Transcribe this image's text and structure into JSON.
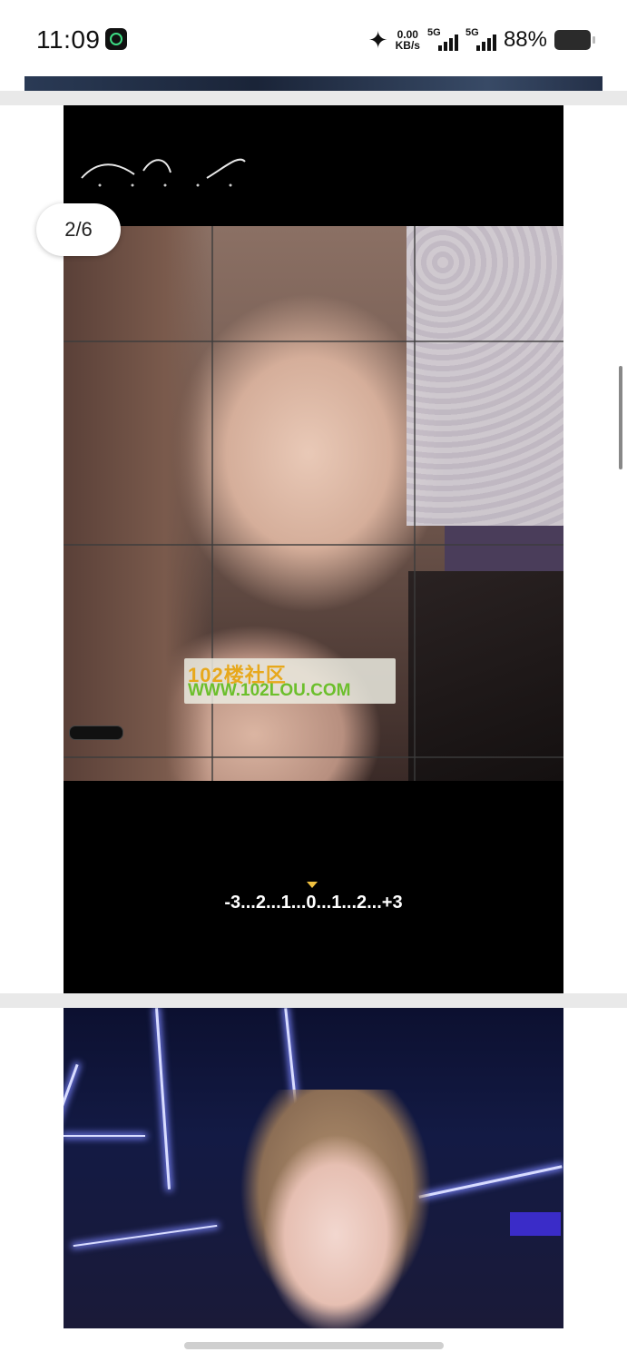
{
  "status_bar": {
    "time": "11:09",
    "net_speed_value": "0.00",
    "net_speed_unit": "KB/s",
    "sim1_label": "5G",
    "sim2_label": "5G",
    "battery_percent": "88%",
    "icons": [
      "app-notification-icon",
      "bluetooth-icon",
      "signal-icon",
      "battery-icon"
    ]
  },
  "viewer": {
    "page_indicator": "2/6"
  },
  "photo_1": {
    "watermark_title": "102楼社区",
    "watermark_url": "WWW.102LOU.COM",
    "exposure_scale": "-3...2...1...0...1...2...+3"
  },
  "photo_2": {}
}
